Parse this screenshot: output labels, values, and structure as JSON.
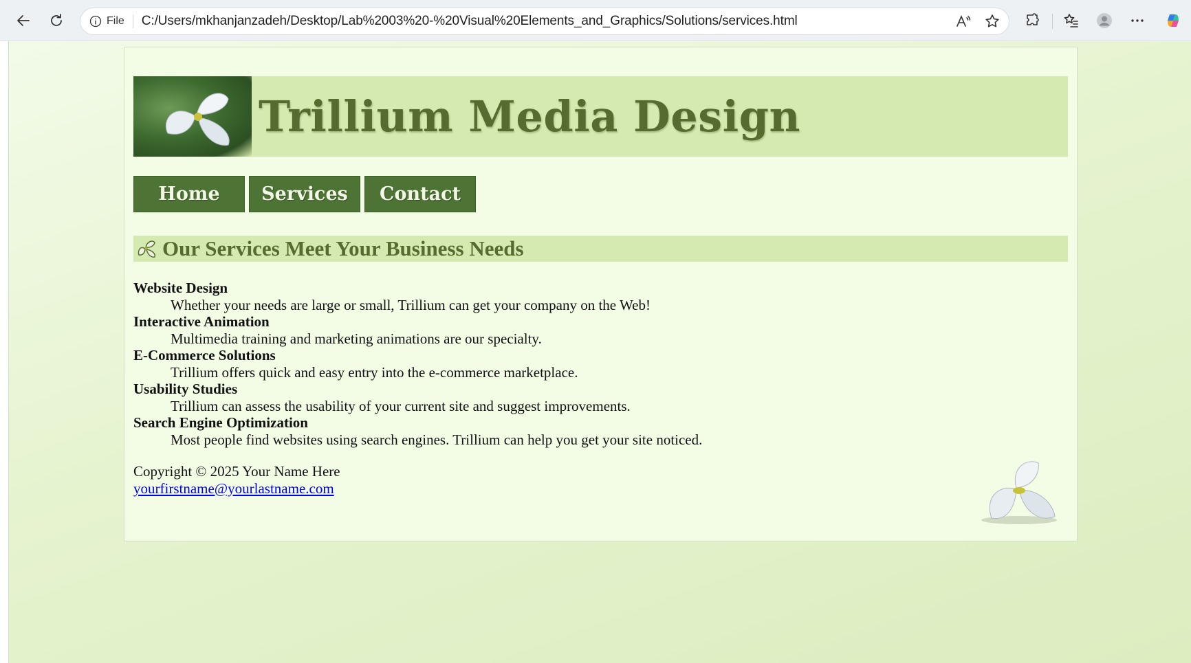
{
  "browser": {
    "url_scheme_label": "File",
    "url": "C:/Users/mkhanjanzadeh/Desktop/Lab%2003%20-%20Visual%20Elements_and_Graphics/Solutions/services.html"
  },
  "page": {
    "banner_title": "Trillium Media Design",
    "nav": [
      {
        "label": "Home"
      },
      {
        "label": "Services"
      },
      {
        "label": "Contact"
      }
    ],
    "section_heading": "Our Services Meet Your Business Needs",
    "services": [
      {
        "term": "Website Design",
        "description": "Whether your needs are large or small, Trillium can get your company on the Web!"
      },
      {
        "term": "Interactive Animation",
        "description": "Multimedia training and marketing animations are our specialty."
      },
      {
        "term": "E-Commerce Solutions",
        "description": "Trillium offers quick and easy entry into the e-commerce marketplace."
      },
      {
        "term": "Usability Studies",
        "description": "Trillium can assess the usability of your current site and suggest improvements."
      },
      {
        "term": "Search Engine Optimization",
        "description": "Most people find websites using search engines. Trillium can help you get your site noticed."
      }
    ],
    "footer": {
      "copyright": "Copyright © 2025 Your Name Here",
      "email": "yourfirstname@yourlastname.com"
    }
  },
  "colors": {
    "accent_dark_green": "#4d7335",
    "heading_olive": "#556b2f",
    "banner_bg": "#d5eab0",
    "page_bg": "#f3fde6"
  }
}
